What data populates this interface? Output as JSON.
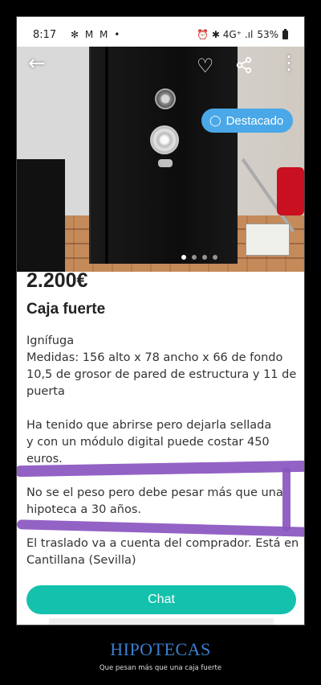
{
  "status_bar": {
    "time": "8:17",
    "notification_icons": "✻ M M •",
    "right_icons": "⏰ ✱ 4G⁺ .ıl",
    "battery": "53%"
  },
  "toolbar": {
    "back_icon": "arrow-left-icon",
    "favorite_icon": "heart-icon",
    "share_icon": "share-icon",
    "more_icon": "more-vert-icon"
  },
  "badge": {
    "label": "Destacado",
    "icon": "tag-icon",
    "color": "#4aa8e8"
  },
  "carousel": {
    "count": 4,
    "active": 1
  },
  "listing": {
    "price": "2.200€",
    "title": "Caja fuerte",
    "description": [
      [
        "Ignífuga",
        "Medidas: 156 alto x 78 ancho x 66 de fondo",
        "10,5 de grosor de pared de estructura y 11 de",
        "puerta"
      ],
      [
        "Ha tenido que abrirse pero dejarla sellada",
        "y con un módulo digital puede costar 450",
        "euros."
      ],
      [
        "No se el peso pero debe pesar más que una",
        "hipoteca a 30 años."
      ],
      [
        "El traslado va a cuenta del comprador. Está en",
        "Cantillana (Sevilla)"
      ]
    ]
  },
  "actions": {
    "chat_label": "Chat",
    "accent": "#13c1ac"
  },
  "caption": {
    "title": "HIPOTECAS",
    "subtitle": "Que pesan más que una caja fuerte",
    "title_color": "#3a7fd0"
  },
  "highlight_color": "#8a55c0"
}
